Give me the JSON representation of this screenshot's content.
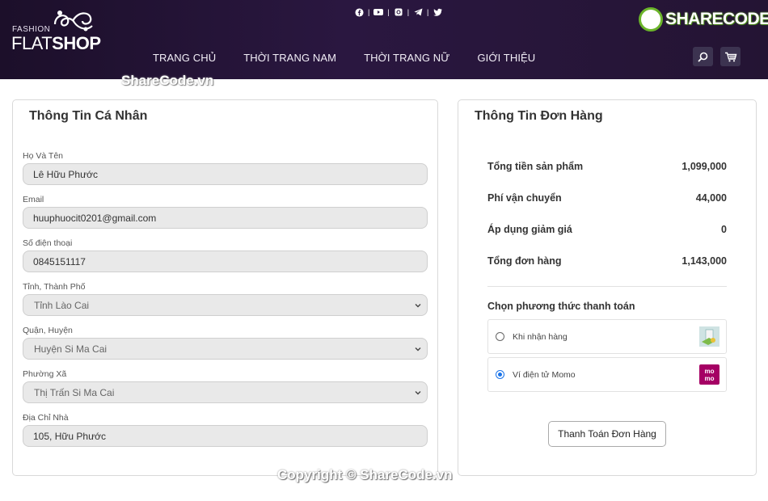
{
  "header": {
    "logo_small": "FASHION",
    "logo_part1": "FLAT",
    "logo_part2": "SHOP",
    "social_icons": [
      "facebook-icon",
      "youtube-icon",
      "instagram-icon",
      "telegram-icon",
      "twitter-icon"
    ],
    "nav": [
      "TRANG CHỦ",
      "THỜI TRANG NAM",
      "THỜI TRANG NỮ",
      "GIỚI THIỆU"
    ],
    "watermark_brand": "SHARECODE.vn",
    "watermark_sub": "ShareCode.vn"
  },
  "personal": {
    "title": "Thông Tin Cá Nhân",
    "name_label": "Họ Và Tên",
    "name_value": "Lê Hữu Phước",
    "email_label": "Email",
    "email_value": "huuphuocit0201@gmail.com",
    "phone_label": "Số điện thoại",
    "phone_value": "0845151117",
    "province_label": "Tỉnh, Thành Phố",
    "province_value": "Tỉnh Lào Cai",
    "district_label": "Quận, Huyện",
    "district_value": "Huyện Si Ma Cai",
    "ward_label": "Phường Xã",
    "ward_value": "Thị Trấn Si Ma Cai",
    "address_label": "Địa Chỉ Nhà",
    "address_value": "105, Hữu Phước"
  },
  "order": {
    "title": "Thông Tin Đơn Hàng",
    "rows": [
      {
        "label": "Tổng tiền sản phẩm",
        "value": "1,099,000"
      },
      {
        "label": "Phí vận chuyển",
        "value": "44,000"
      },
      {
        "label": "Áp dụng giảm giá",
        "value": "0"
      },
      {
        "label": "Tổng đơn hàng",
        "value": "1,143,000"
      }
    ],
    "payment_title": "Chọn phương thức thanh toán",
    "payment_options": [
      {
        "label": "Khi nhận hàng",
        "selected": false
      },
      {
        "label": "Ví điện tử Momo",
        "selected": true
      }
    ],
    "momo_text_top": "mo",
    "momo_text_bottom": "mo",
    "pay_button": "Thanh Toán Đơn Hàng"
  },
  "footer": {
    "copyright": "Copyright © ShareCode.vn"
  },
  "colors": {
    "header_bg": "#241433",
    "momo": "#a50064",
    "radio_accent": "#1a73e8"
  }
}
